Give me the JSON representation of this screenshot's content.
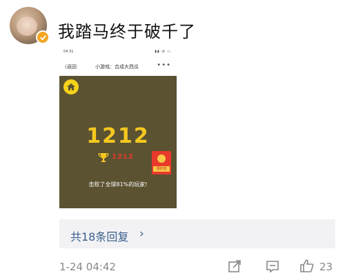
{
  "post": {
    "text": "我踏马终于破千了",
    "date": "1-24 04:42",
    "replies_label": "共18条回复",
    "likes": "23"
  },
  "screenshot": {
    "status_time": "04:31",
    "back_label": "〈返回",
    "title": "小游戏：合成大西瓜",
    "more": "•••",
    "score": "1212",
    "best": "1212",
    "redpacket_label": "领红包",
    "beat_text": "击败了全球81%的玩家!"
  },
  "colors": {
    "game_bg": "#5b5232",
    "score": "#f5c81f",
    "best": "#e23a2a",
    "link": "#3b5e8c",
    "verified_badge": "#f5a623"
  },
  "icons": [
    "verified-icon",
    "home-icon",
    "trophy-icon",
    "redpacket-icon",
    "chevron-right-icon",
    "share-icon",
    "comment-icon",
    "like-icon"
  ]
}
